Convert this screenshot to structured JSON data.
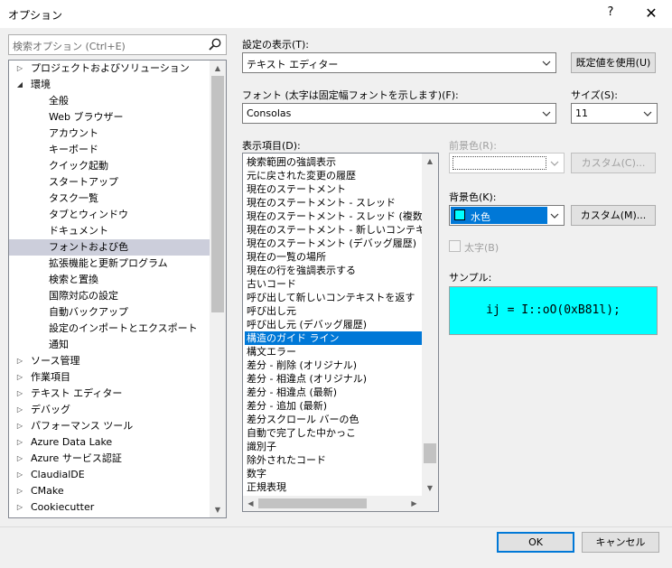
{
  "window": {
    "title": "オプション",
    "help": "?",
    "close": "✕"
  },
  "search": {
    "placeholder": "検索オプション (Ctrl+E)"
  },
  "tree": {
    "items": [
      {
        "label": "プロジェクトおよびソリューション",
        "level": 0,
        "arrow": "right"
      },
      {
        "label": "環境",
        "level": 0,
        "arrow": "down"
      },
      {
        "label": "全般",
        "level": 1
      },
      {
        "label": "Web ブラウザー",
        "level": 1
      },
      {
        "label": "アカウント",
        "level": 1
      },
      {
        "label": "キーボード",
        "level": 1
      },
      {
        "label": "クイック起動",
        "level": 1
      },
      {
        "label": "スタートアップ",
        "level": 1
      },
      {
        "label": "タスク一覧",
        "level": 1
      },
      {
        "label": "タブとウィンドウ",
        "level": 1
      },
      {
        "label": "ドキュメント",
        "level": 1
      },
      {
        "label": "フォントおよび色",
        "level": 1,
        "selected": true
      },
      {
        "label": "拡張機能と更新プログラム",
        "level": 1
      },
      {
        "label": "検索と置換",
        "level": 1
      },
      {
        "label": "国際対応の設定",
        "level": 1
      },
      {
        "label": "自動バックアップ",
        "level": 1
      },
      {
        "label": "設定のインポートとエクスポート",
        "level": 1
      },
      {
        "label": "通知",
        "level": 1
      },
      {
        "label": "ソース管理",
        "level": 0,
        "arrow": "right"
      },
      {
        "label": "作業項目",
        "level": 0,
        "arrow": "right"
      },
      {
        "label": "テキスト エディター",
        "level": 0,
        "arrow": "right"
      },
      {
        "label": "デバッグ",
        "level": 0,
        "arrow": "right"
      },
      {
        "label": "パフォーマンス ツール",
        "level": 0,
        "arrow": "right"
      },
      {
        "label": "Azure Data Lake",
        "level": 0,
        "arrow": "right"
      },
      {
        "label": "Azure サービス認証",
        "level": 0,
        "arrow": "right"
      },
      {
        "label": "ClaudialDE",
        "level": 0,
        "arrow": "right"
      },
      {
        "label": "CMake",
        "level": 0,
        "arrow": "right"
      },
      {
        "label": "Cookiecutter",
        "level": 0,
        "arrow": "right"
      }
    ]
  },
  "settings": {
    "show_settings_label": "設定の表示(T):",
    "show_settings_value": "テキスト エディター",
    "use_defaults_button": "既定値を使用(U)",
    "font_label": "フォント (太字は固定幅フォントを示します)(F):",
    "font_value": "Consolas",
    "size_label": "サイズ(S):",
    "size_value": "11",
    "display_items_label": "表示項目(D):",
    "foreground_label": "前景色(R):",
    "foreground_custom_button": "カスタム(C)...",
    "background_label": "背景色(K):",
    "background_value": "水色",
    "background_color": "#00ffff",
    "background_custom_button": "カスタム(M)...",
    "bold_label": "太字(B)",
    "sample_label": "サンプル:",
    "sample_text": "ij = I::oO(0xB81l);"
  },
  "display_items": [
    "検索範囲の強調表示",
    "元に戻された変更の履歴",
    "現在のステートメント",
    "現在のステートメント - スレッド",
    "現在のステートメント - スレッド (複数)",
    "現在のステートメント - 新しいコンテキスト",
    "現在のステートメント (デバッグ履歴)",
    "現在の一覧の場所",
    "現在の行を強調表示する",
    "古いコード",
    "呼び出して新しいコンテキストを返す",
    "呼び出し元",
    "呼び出し元 (デバッグ履歴)",
    "構造のガイド ライン",
    "構文エラー",
    "差分 - 削除 (オリジナル)",
    "差分 - 相違点 (オリジナル)",
    "差分 - 相違点 (最新)",
    "差分 - 追加 (最新)",
    "差分スクロール バーの色",
    "自動で完了した中かっこ",
    "識別子",
    "除外されたコード",
    "数字",
    "正規表現"
  ],
  "display_items_selected": 13,
  "footer": {
    "ok_button": "OK",
    "cancel_button": "キャンセル"
  },
  "colors": {
    "accent": "#0078d7",
    "selection_inactive": "#cccedb"
  }
}
